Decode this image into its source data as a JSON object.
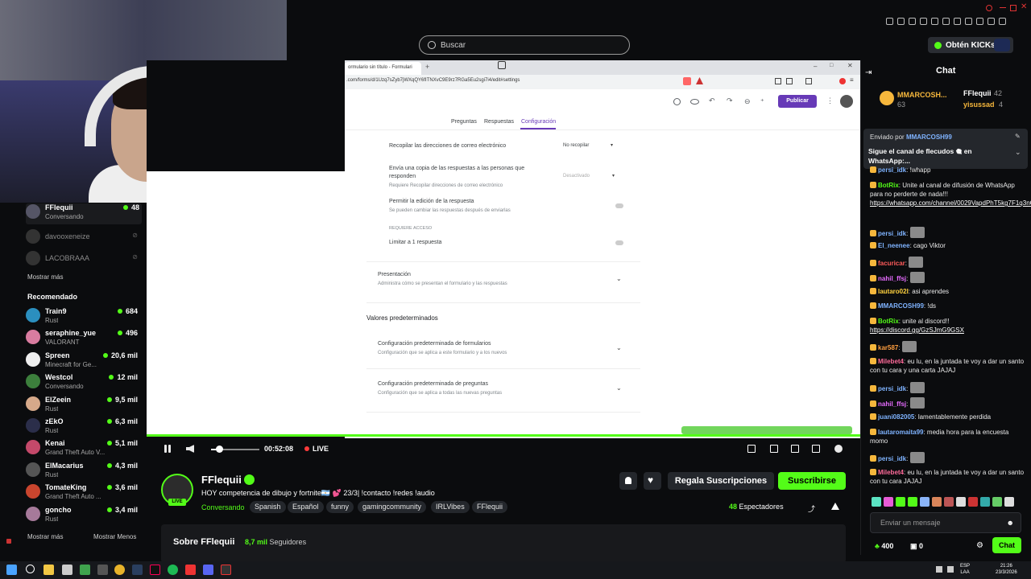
{
  "search": {
    "placeholder": "Buscar"
  },
  "topbar": {
    "kicks_label": "Obtén KICKs"
  },
  "sidebar": {
    "following": [
      {
        "name": "FFlequii",
        "status": "Conversando",
        "viewers": "48"
      },
      {
        "name": "davooxeneize",
        "status": "",
        "viewers": ""
      },
      {
        "name": "LACOBRAAA",
        "status": "",
        "viewers": ""
      }
    ],
    "show_more": "Mostrar más",
    "recommended_title": "Recomendado",
    "recommended": [
      {
        "name": "Train9",
        "category": "Rust",
        "viewers": "684",
        "color": "#2b8fbf"
      },
      {
        "name": "seraphine_yue",
        "category": "VALORANT",
        "viewers": "496",
        "color": "#d97ca0"
      },
      {
        "name": "Spreen",
        "category": "Minecraft for Ge...",
        "viewers": "20,6 mil",
        "color": "#eeeeee"
      },
      {
        "name": "Westcol",
        "category": "Conversando",
        "viewers": "12 mil",
        "color": "#3c7f3c"
      },
      {
        "name": "ElZeein",
        "category": "Rust",
        "viewers": "9,5 mil",
        "color": "#d6a98a"
      },
      {
        "name": "zEkO",
        "category": "Rust",
        "viewers": "6,3 mil",
        "color": "#2b2e4a"
      },
      {
        "name": "Kenai",
        "category": "Grand Theft Auto V...",
        "viewers": "5,1 mil",
        "color": "#c4496a"
      },
      {
        "name": "ElMacarius",
        "category": "Rust",
        "viewers": "4,3 mil",
        "color": "#555555"
      },
      {
        "name": "TomateKing",
        "category": "Grand Theft Auto ...",
        "viewers": "3,6 mil",
        "color": "#c9452e"
      },
      {
        "name": "goncho",
        "category": "Rust",
        "viewers": "3,4 mil",
        "color": "#a67a9a"
      }
    ],
    "show_more_bottom": "Mostrar más",
    "show_less": "Mostrar Menos"
  },
  "browser": {
    "tab_title": "ormulario sin título - Formulari",
    "url": ".com/forms/d/1Uzq7sZyb7jWXqQY6fITNXvC9E9rz7RGa5Eu2sgi7i4/edit#settings",
    "publish": "Publicar",
    "tabs": [
      "Preguntas",
      "Respuestas",
      "Configuración"
    ],
    "settings": {
      "collect_emails": "Recopilar las direcciones de correo electrónico",
      "collect_emails_value": "No recopilar",
      "send_copy_line1": "Envía una copia de las respuestas a las personas que",
      "send_copy_line2": "responden",
      "send_copy_requires": "Requiere Recopilar direcciones de correo electrónico",
      "send_copy_value": "Desactivado",
      "allow_edit": "Permitir la edición de la respuesta",
      "allow_edit_sub": "Se pueden cambiar las respuestas después de enviarlas",
      "requires_access": "REQUIERE ACCESO",
      "limit_one": "Limitar a 1 respuesta",
      "presentation": "Presentación",
      "presentation_sub": "Administra cómo se presentan el formulario y las respuestas",
      "defaults_title": "Valores predeterminados",
      "form_defaults": "Configuración predeterminada de formularios",
      "form_defaults_sub": "Configuración que se aplica a este formulario y a los nuevos",
      "question_defaults": "Configuración predeterminada de preguntas",
      "question_defaults_sub": "Configuración que se aplica a todas las nuevas preguntas"
    }
  },
  "player": {
    "volume_pct": "16%",
    "time": "00:52:08",
    "live": "LIVE",
    "progress": 1.0
  },
  "stream": {
    "streamer": "FFlequii",
    "live_badge": "LIVE",
    "title": "HOY competencia de dibujo y fortnite🇦🇷 💕 23/3| !contacto !redes !audio",
    "category": "Conversando",
    "tags": [
      "Spanish",
      "Español",
      "funny",
      "gamingcommunity",
      "IRLVibes",
      "FFlequii"
    ],
    "gift_subs": "Regala Suscripciones",
    "subscribe": "Suscribirse",
    "viewers_count": "48",
    "viewers_label": "Espectadores",
    "about_title": "Sobre FFlequii",
    "followers_count": "8,7 mil",
    "followers_label": "Seguidores"
  },
  "chat": {
    "title": "Chat",
    "top_gifters": [
      {
        "name": "MMARCOSH...",
        "count": "63"
      },
      {
        "name": "FFlequii",
        "count": "42"
      },
      {
        "name": "yisussad",
        "count": "4"
      }
    ],
    "pinned_by_label": "Enviado por",
    "pinned_by": "MMARCOSH99",
    "pinned_text": "Sigue el canal de flecudos 🎕 en WhatsApp:...",
    "messages": [
      {
        "user": "persi_idk",
        "text": "!whapp",
        "color": "#7fb3ff"
      },
      {
        "user": "BotRix",
        "text": "Unite al canal de difusión de WhatsApp para no perderte de nada!!!",
        "link": "https://whatsapp.com/channel/0029VapdPhT5kg7F1q3nCd3b",
        "color": "#53fc18"
      },
      {
        "user": "persi_idk",
        "text": "",
        "emote": true,
        "color": "#7fb3ff"
      },
      {
        "user": "El_neenee",
        "text": "cago Viktor",
        "color": "#7fb3ff"
      },
      {
        "user": "facuricar",
        "text": "",
        "emote": true,
        "color": "#ff5b5b"
      },
      {
        "user": "nahil_ffsj",
        "text": "",
        "emote": true,
        "color": "#e66bff"
      },
      {
        "user": "lautaro02l",
        "text": "asi aprendes",
        "color": "#ffd23f"
      },
      {
        "user": "MMARCOSH99",
        "text": "!ds",
        "color": "#7fb3ff"
      },
      {
        "user": "BotRix",
        "text": "unite al discord!!",
        "link": "https://discord.gg/GzSJmG9GSX",
        "color": "#53fc18"
      },
      {
        "user": "kar587",
        "text": "",
        "emote": true,
        "color": "#ff9f3f"
      },
      {
        "user": "Milebet4",
        "text": "eu lu, en la juntada te voy a dar un santo con tu cara y una carta JAJAJ",
        "color": "#ff6b9a"
      },
      {
        "user": "persi_idk",
        "text": "",
        "emote": true,
        "color": "#7fb3ff"
      },
      {
        "user": "nahil_ffsj",
        "text": "",
        "emote": true,
        "color": "#e66bff"
      },
      {
        "user": "juani082005",
        "text": "lamentablemente perdida",
        "color": "#7fb3ff"
      },
      {
        "user": "lautaromaita99",
        "text": "media hora para la encuesta momo",
        "color": "#7fb3ff"
      },
      {
        "user": "persi_idk",
        "text": "",
        "emote": true,
        "color": "#7fb3ff"
      },
      {
        "user": "Milebet4",
        "text": "eu lu, en la juntada te voy a dar un santo con tu cara JAJAJ",
        "color": "#ff6b9a"
      }
    ],
    "input_placeholder": "Enviar un mensaje",
    "points": "400",
    "redeems": "0",
    "send": "Chat"
  },
  "taskbar": {
    "lang_top": "ESP",
    "lang_bottom": "LAA",
    "time": "21:26",
    "date": "23/3/2026"
  },
  "colors": {
    "accent": "#53fc18",
    "forms_purple": "#673ab7",
    "background": "#0b0c0e"
  }
}
